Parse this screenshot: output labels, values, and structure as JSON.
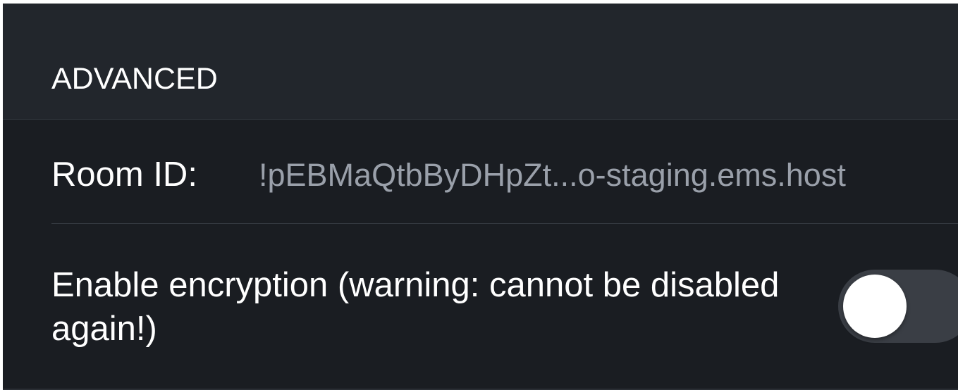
{
  "section": {
    "title": "ADVANCED"
  },
  "room_id": {
    "label": "Room ID:",
    "value": "!pEBMaQtbByDHpZt...o-staging.ems.host"
  },
  "encryption": {
    "label": "Enable encryption (warning: cannot be disabled again!)",
    "enabled": false
  },
  "colors": {
    "background": "#22262c",
    "group_background": "#1a1d22",
    "text_primary": "#ffffff",
    "text_secondary": "#9aa0aa",
    "toggle_off_track": "#3a3e45"
  }
}
